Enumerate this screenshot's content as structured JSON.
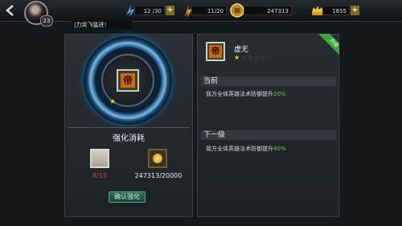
{
  "header": {
    "player_level": "23",
    "resources": [
      {
        "name": "stamina",
        "icon": "stamina-icon",
        "value": "12 /30",
        "has_plus": true
      },
      {
        "name": "energy",
        "icon": "energy-icon",
        "value": "11/20",
        "has_plus": false
      },
      {
        "name": "gold",
        "icon": "gold-coin-icon",
        "value": "247313",
        "has_plus": false
      },
      {
        "name": "ingot",
        "icon": "ingot-icon",
        "value": "1855",
        "has_plus": true
      }
    ],
    "plus_label": "+",
    "ticker_text": "|力突飞猛进！"
  },
  "left_panel": {
    "skill_glyph": "帝",
    "skill_star": "★",
    "cost_title": "强化消耗",
    "items": [
      {
        "icon": "scroll-icon",
        "count": "8/15",
        "sufficient": false
      },
      {
        "icon": "gold-pile-icon",
        "count": "247313/20000",
        "sufficient": true
      }
    ],
    "confirm_label": "确认强化"
  },
  "right_panel": {
    "skill_glyph": "帝",
    "skill_name": "虚无",
    "stars_on": "★",
    "stars_off": "☆☆☆☆",
    "stars": {
      "filled": 1,
      "total": 5
    },
    "ribbon_label": "升级",
    "current_label": "当前",
    "current_desc_prefix": "我方全体英雄法术防御提升",
    "current_value": "20%",
    "next_label": "下一级",
    "next_desc_prefix": "我方全体英雄法术防御提升",
    "next_value": "40%"
  },
  "colors": {
    "accent_green": "#3ea645",
    "percent_green": "#5fd150",
    "insufficient_red": "#e0453a",
    "star_gold": "#f0c53a"
  }
}
